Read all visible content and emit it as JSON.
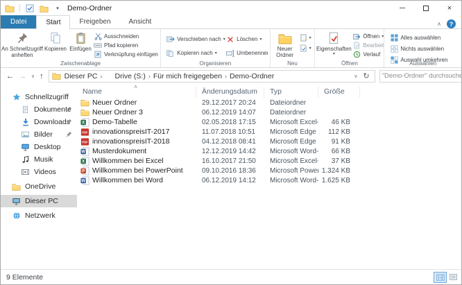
{
  "colors": {
    "datei_tab": "#2b7cb1",
    "help_icon": "#2a7fc1",
    "selection_gray": "#d9d9d9",
    "folder_yellow": "#ffd976",
    "word_blue": "#2b579a",
    "excel_green": "#217346",
    "powerpoint_orange": "#d04423",
    "pdf_red": "#c8342c",
    "delete_red": "#d23b2e"
  },
  "titlebar": {
    "title": "Demo-Ordner"
  },
  "tabs": {
    "items": [
      {
        "label": "Datei",
        "style": "file"
      },
      {
        "label": "Start",
        "style": "active"
      },
      {
        "label": "Freigeben",
        "style": "normal"
      },
      {
        "label": "Ansicht",
        "style": "normal"
      }
    ]
  },
  "ribbon": {
    "groups": {
      "clipboard": "Zwischenablage",
      "organize": "Organisieren",
      "new": "Neu",
      "open": "Öffnen",
      "select": "Auswählen"
    },
    "pin_to_quick_access": "An Schnellzugriff anheften",
    "copy": "Kopieren",
    "paste": "Einfügen",
    "cut": "Ausschneiden",
    "copy_path": "Pfad kopieren",
    "paste_shortcut": "Verknüpfung einfügen",
    "move_to": "Verschieben nach",
    "copy_to": "Kopieren nach",
    "delete": "Löschen",
    "rename": "Umbenennen",
    "new_folder": "Neuer Ordner",
    "properties": "Eigenschaften",
    "open_item": "Öffnen",
    "edit": "Bearbeiten",
    "history": "Verlauf",
    "select_all": "Alles auswählen",
    "select_none": "Nichts auswählen",
    "invert_selection": "Auswahl umkehren"
  },
  "address": {
    "path": [
      "Dieser PC",
      "Drive (S:)",
      "Für mich freigegeben",
      "Demo-Ordner"
    ],
    "search_placeholder": "\"Demo-Ordner\" durchsuchen"
  },
  "sidebar": {
    "items": [
      {
        "label": "Schnellzugriff",
        "icon": "quick-access-icon",
        "level": 0,
        "pinned": false,
        "selected": false,
        "gap": false
      },
      {
        "label": "Dokumente",
        "icon": "documents-icon",
        "level": 1,
        "pinned": true,
        "selected": false,
        "gap": false
      },
      {
        "label": "Downloads",
        "icon": "downloads-icon",
        "level": 1,
        "pinned": true,
        "selected": false,
        "gap": false
      },
      {
        "label": "Bilder",
        "icon": "pictures-icon",
        "level": 1,
        "pinned": true,
        "selected": false,
        "gap": false
      },
      {
        "label": "Desktop",
        "icon": "desktop-icon",
        "level": 1,
        "pinned": false,
        "selected": false,
        "gap": false
      },
      {
        "label": "Musik",
        "icon": "music-icon",
        "level": 1,
        "pinned": false,
        "selected": false,
        "gap": false
      },
      {
        "label": "Videos",
        "icon": "videos-icon",
        "level": 1,
        "pinned": false,
        "selected": false,
        "gap": false
      },
      {
        "label": "OneDrive",
        "icon": "onedrive-icon",
        "level": 0,
        "pinned": false,
        "selected": false,
        "gap": true
      },
      {
        "label": "Dieser PC",
        "icon": "computer-icon",
        "level": 0,
        "pinned": false,
        "selected": true,
        "gap": true
      },
      {
        "label": "Netzwerk",
        "icon": "network-icon",
        "level": 0,
        "pinned": false,
        "selected": false,
        "gap": true
      }
    ]
  },
  "filelist": {
    "columns": [
      "Name",
      "Änderungsdatum",
      "Typ",
      "Größe"
    ],
    "sort": {
      "column": "Name",
      "direction": "ascending"
    },
    "rows": [
      {
        "name": "Neuer Ordner",
        "date": "29.12.2017 20:24",
        "type": "Dateiordner",
        "size": "",
        "icon": "folder-icon"
      },
      {
        "name": "Neuer Ordner 3",
        "date": "06.12.2019 14:07",
        "type": "Dateiordner",
        "size": "",
        "icon": "folder-icon"
      },
      {
        "name": "Demo-Tabelle",
        "date": "02.05.2018 17:15",
        "type": "Microsoft Excel-A...",
        "size": "46 KB",
        "icon": "excel-file-icon"
      },
      {
        "name": "innovationspreisIT-2017",
        "date": "11.07.2018 10:51",
        "type": "Microsoft Edge P...",
        "size": "112 KB",
        "icon": "pdf-file-icon"
      },
      {
        "name": "innovationspreisIT-2018",
        "date": "04.12.2018 08:41",
        "type": "Microsoft Edge P...",
        "size": "91 KB",
        "icon": "pdf-file-icon"
      },
      {
        "name": "Musterdokument",
        "date": "12.12.2019 14:42",
        "type": "Microsoft Word-D...",
        "size": "66 KB",
        "icon": "word-file-icon"
      },
      {
        "name": "Willkommen bei Excel",
        "date": "16.10.2017 21:50",
        "type": "Microsoft Excel-A...",
        "size": "37 KB",
        "icon": "excel-file-icon"
      },
      {
        "name": "Willkommen bei PowerPoint",
        "date": "09.10.2016 18:36",
        "type": "Microsoft PowerP...",
        "size": "1.324 KB",
        "icon": "powerpoint-file-icon"
      },
      {
        "name": "Willkommen bei Word",
        "date": "06.12.2019 14:12",
        "type": "Microsoft Word-D...",
        "size": "1.625 KB",
        "icon": "word-file-icon"
      }
    ]
  },
  "statusbar": {
    "item_count": "9 Elemente"
  }
}
